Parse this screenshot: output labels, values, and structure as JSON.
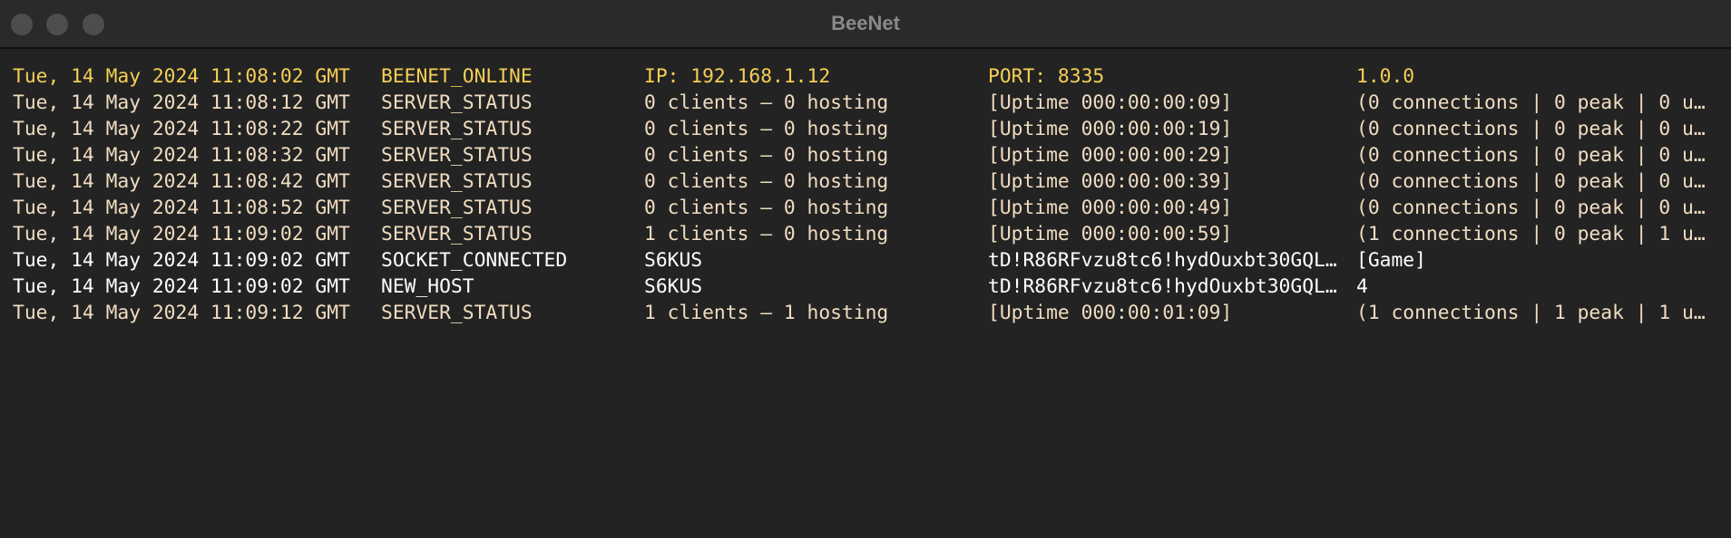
{
  "window": {
    "title": "BeeNet"
  },
  "colors": {
    "background": "#232323",
    "online": "#f6cf55",
    "status": "#f0dcc0",
    "event": "#ffffff"
  },
  "log": [
    {
      "style": "yellow",
      "cols": [
        "Tue, 14 May 2024 11:08:02 GMT",
        "BEENET_ONLINE",
        "IP: 192.168.1.12",
        "PORT: 8335",
        "1.0.0"
      ]
    },
    {
      "style": "beige",
      "cols": [
        "Tue, 14 May 2024 11:08:12 GMT",
        "SERVER_STATUS",
        "0 clients – 0 hosting",
        "[Uptime 000:00:00:09]",
        "(0 connections | 0 peak | 0 u…"
      ]
    },
    {
      "style": "beige",
      "cols": [
        "Tue, 14 May 2024 11:08:22 GMT",
        "SERVER_STATUS",
        "0 clients – 0 hosting",
        "[Uptime 000:00:00:19]",
        "(0 connections | 0 peak | 0 u…"
      ]
    },
    {
      "style": "beige",
      "cols": [
        "Tue, 14 May 2024 11:08:32 GMT",
        "SERVER_STATUS",
        "0 clients – 0 hosting",
        "[Uptime 000:00:00:29]",
        "(0 connections | 0 peak | 0 u…"
      ]
    },
    {
      "style": "beige",
      "cols": [
        "Tue, 14 May 2024 11:08:42 GMT",
        "SERVER_STATUS",
        "0 clients – 0 hosting",
        "[Uptime 000:00:00:39]",
        "(0 connections | 0 peak | 0 u…"
      ]
    },
    {
      "style": "beige",
      "cols": [
        "Tue, 14 May 2024 11:08:52 GMT",
        "SERVER_STATUS",
        "0 clients – 0 hosting",
        "[Uptime 000:00:00:49]",
        "(0 connections | 0 peak | 0 u…"
      ]
    },
    {
      "style": "beige",
      "cols": [
        "Tue, 14 May 2024 11:09:02 GMT",
        "SERVER_STATUS",
        "1 clients – 0 hosting",
        "[Uptime 000:00:00:59]",
        "(1 connections | 0 peak | 1 u…"
      ]
    },
    {
      "style": "white",
      "cols": [
        "Tue, 14 May 2024 11:09:02 GMT",
        "SOCKET_CONNECTED",
        "S6KUS",
        "tD!R86RFvzu8tc6!hydOuxbt30GQL…",
        "[Game]"
      ]
    },
    {
      "style": "white",
      "cols": [
        "Tue, 14 May 2024 11:09:02 GMT",
        "NEW_HOST",
        "S6KUS",
        "tD!R86RFvzu8tc6!hydOuxbt30GQL…",
        "4"
      ]
    },
    {
      "style": "beige",
      "cols": [
        "Tue, 14 May 2024 11:09:12 GMT",
        "SERVER_STATUS",
        "1 clients – 1 hosting",
        "[Uptime 000:00:01:09]",
        "(1 connections | 1 peak | 1 u…"
      ]
    }
  ]
}
